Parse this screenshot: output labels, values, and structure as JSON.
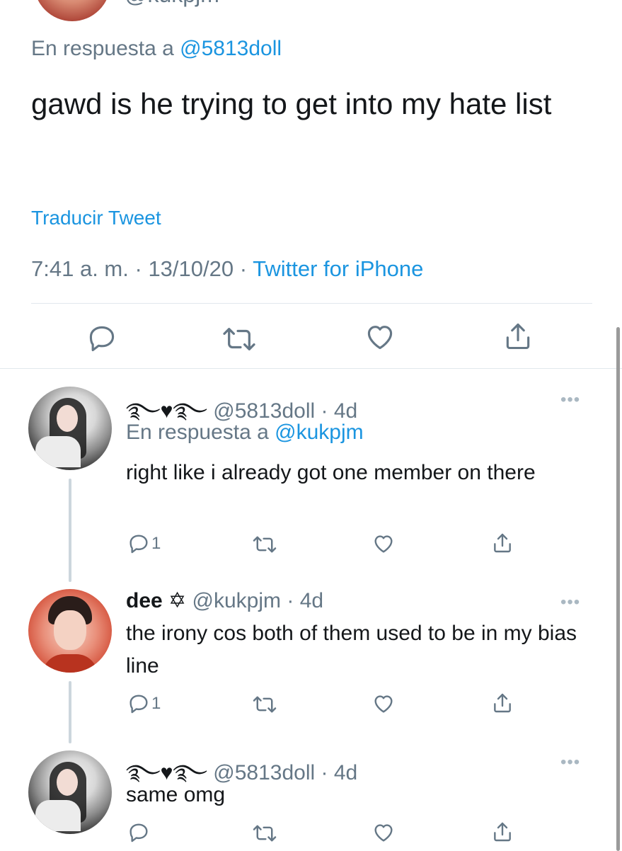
{
  "main_tweet": {
    "cut_off_handle": "@kukpjm",
    "reply_prefix": "En respuesta a ",
    "reply_to": "@5813doll",
    "text": "gawd is he trying to get into my hate list",
    "translate_label": "Traducir Tweet",
    "time": "7:41 a. m.",
    "date": "13/10/20",
    "separator": "·",
    "source": "Twitter for iPhone",
    "actions": {
      "reply_icon": "reply-icon",
      "retweet_icon": "retweet-icon",
      "like_icon": "heart-icon",
      "share_icon": "share-icon"
    }
  },
  "replies": [
    {
      "display_name": "࿐♥︎࿐",
      "handle": "@5813doll",
      "age": "4d",
      "reply_prefix": "En respuesta a ",
      "reply_to": "@kukpjm",
      "text": "right like i already got one member on there",
      "reply_count": "1",
      "more_label": "•••"
    },
    {
      "display_name": "dee",
      "name_symbol": "✡︎",
      "handle": "@kukpjm",
      "age": "4d",
      "text": "the irony cos both of them used to be in my bias line",
      "reply_count": "1",
      "more_label": "•••"
    },
    {
      "display_name": "࿐♥︎࿐",
      "handle": "@5813doll",
      "age": "4d",
      "text": "same omg",
      "more_label": "•••"
    }
  ],
  "colors": {
    "link": "#1b95e0",
    "secondary_text": "#657786",
    "primary_text": "#14171a",
    "divider": "#e1e8ed",
    "thread_line": "#ccd6dd"
  }
}
